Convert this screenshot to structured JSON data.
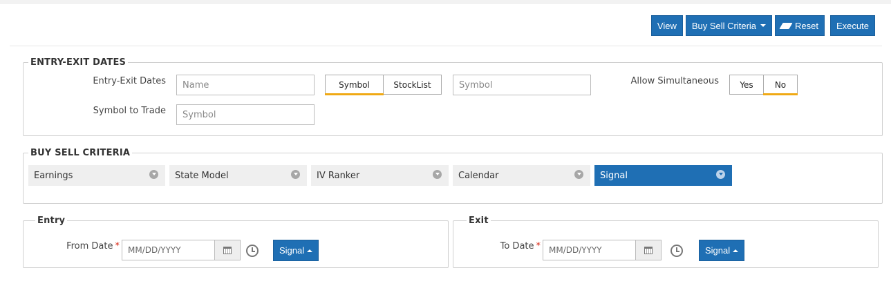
{
  "toolbar": {
    "view_label": "View",
    "buy_sell_label": "Buy Sell Criteria",
    "reset_label": "Reset",
    "execute_label": "Execute"
  },
  "entry_exit": {
    "legend": "ENTRY-EXIT DATES",
    "entry_exit_dates_label": "Entry-Exit Dates",
    "name_placeholder": "Name",
    "symbol_toggle": {
      "options": [
        "Symbol",
        "StockList"
      ],
      "selected": "Symbol"
    },
    "symbol_placeholder": "Symbol",
    "allow_simultaneous_label": "Allow Simultaneous",
    "allow_toggle": {
      "options": [
        "Yes",
        "No"
      ],
      "selected": "No"
    },
    "symbol_to_trade_label": "Symbol to Trade",
    "symbol_to_trade_placeholder": "Symbol"
  },
  "buy_sell": {
    "legend": "BUY SELL CRITERIA",
    "items": [
      "Earnings",
      "State Model",
      "IV Ranker",
      "Calendar",
      "Signal"
    ],
    "active": "Signal"
  },
  "entry": {
    "legend": "Entry",
    "from_date_label": "From Date",
    "required_mark": "*",
    "date_placeholder": "MM/DD/YYYY",
    "signal_label": "Signal"
  },
  "exit": {
    "legend": "Exit",
    "to_date_label": "To Date",
    "required_mark": "*",
    "date_placeholder": "MM/DD/YYYY",
    "signal_label": "Signal"
  },
  "colors": {
    "primary": "#1f6fb4",
    "toggle_accent": "#f0a914",
    "required": "#d9230f"
  }
}
